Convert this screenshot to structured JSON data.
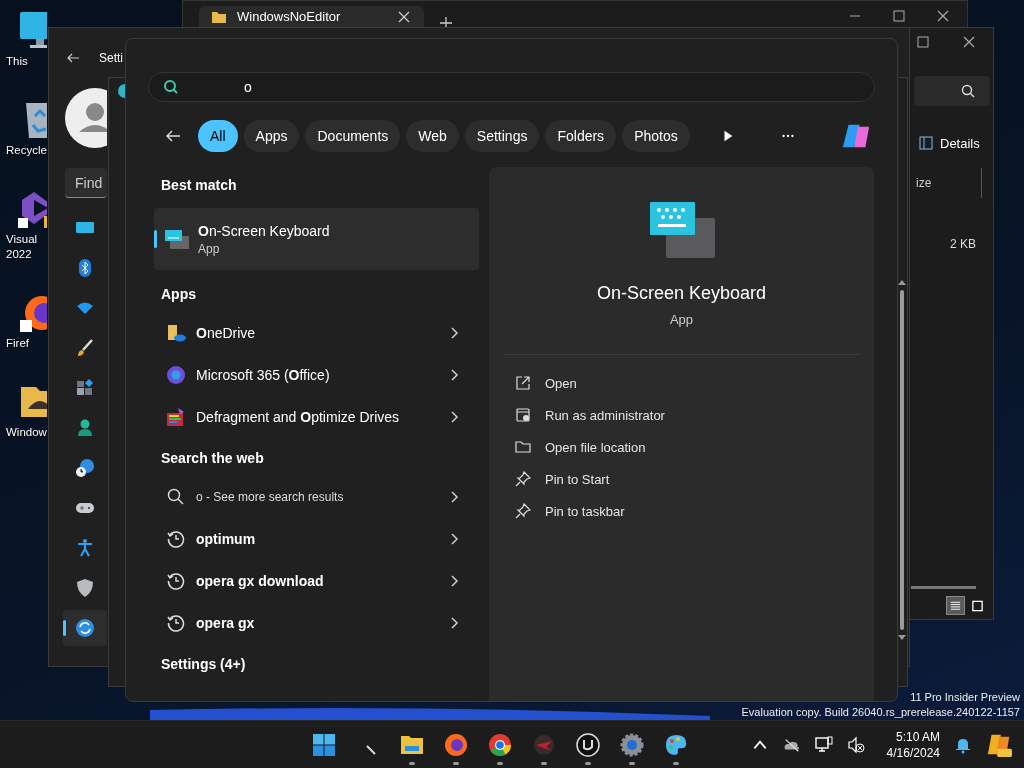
{
  "desktop_icons": [
    {
      "kind": "monitor",
      "lines": [
        "This"
      ]
    },
    {
      "kind": "recycle",
      "lines": [
        "Recycle"
      ]
    },
    {
      "kind": "vs",
      "lines": [
        "Visual",
        "2022"
      ]
    },
    {
      "kind": "firefox",
      "lines": [
        "Firef"
      ]
    },
    {
      "kind": "folder",
      "lines": [
        "Window"
      ]
    }
  ],
  "explorer_tab": {
    "title": "WindowsNoEditor"
  },
  "explorer": {
    "details": "Details",
    "column_1": "ize",
    "file_size": "2 KB",
    "views": [
      {
        "kind": "details",
        "selected": true
      },
      {
        "kind": "tiles",
        "selected": false
      }
    ]
  },
  "settings": {
    "title": "Setti",
    "search_placeholder": "Find",
    "nav": [
      {
        "kind": "display",
        "selected": false
      },
      {
        "kind": "bluetooth",
        "selected": false
      },
      {
        "kind": "wifi",
        "selected": false
      },
      {
        "kind": "brush",
        "selected": false
      },
      {
        "kind": "apps",
        "selected": false
      },
      {
        "kind": "account",
        "selected": false
      },
      {
        "kind": "time",
        "selected": false
      },
      {
        "kind": "gaming",
        "selected": false
      },
      {
        "kind": "accessibility",
        "selected": false
      },
      {
        "kind": "shield",
        "selected": false
      },
      {
        "kind": "update",
        "selected": true
      }
    ]
  },
  "search": {
    "query": "o",
    "filters": [
      {
        "label": "All",
        "selected": true
      },
      {
        "label": "Apps",
        "selected": false
      },
      {
        "label": "Documents",
        "selected": false
      },
      {
        "label": "Web",
        "selected": false
      },
      {
        "label": "Settings",
        "selected": false
      },
      {
        "label": "Folders",
        "selected": false
      },
      {
        "label": "Photos",
        "selected": false
      }
    ],
    "best_match_heading": "Best match",
    "best_match": {
      "name": "**O**n-Screen Keyboard",
      "type": "App",
      "selected": true
    },
    "apps_heading": "Apps",
    "apps": [
      {
        "kind": "onedrive",
        "name": "**O**neDrive"
      },
      {
        "kind": "m365",
        "name": "Microsoft 365 (**O**ffice)"
      },
      {
        "kind": "defrag",
        "name": "Defragment and **O**ptimize Drives"
      }
    ],
    "web_heading": "Search the web",
    "web": [
      {
        "kind": "search",
        "text": "o - See more search results"
      },
      {
        "kind": "history",
        "text": "optimum"
      },
      {
        "kind": "history",
        "text": "opera gx download"
      },
      {
        "kind": "history",
        "text": "opera gx"
      }
    ],
    "settings_heading": "Settings (4+)",
    "detail": {
      "name": "On-Screen Keyboard",
      "type": "App",
      "actions": [
        {
          "kind": "open",
          "label": "Open"
        },
        {
          "kind": "admin",
          "label": "Run as administrator"
        },
        {
          "kind": "folder",
          "label": "Open file location"
        },
        {
          "kind": "pin",
          "label": "Pin to Start"
        },
        {
          "kind": "pin",
          "label": "Pin to taskbar"
        }
      ]
    }
  },
  "build_info": [
    "11 Pro Insider Preview",
    "Evaluation copy. Build 26040.rs_prerelease.240122-1157"
  ],
  "taskbar": {
    "apps": [
      {
        "kind": "start",
        "running": false
      },
      {
        "kind": "pen",
        "running": false
      },
      {
        "kind": "explorer",
        "running": true
      },
      {
        "kind": "firefox",
        "running": true
      },
      {
        "kind": "chrome",
        "running": true
      },
      {
        "kind": "game",
        "running": true
      },
      {
        "kind": "unreal",
        "running": true
      },
      {
        "kind": "settings",
        "running": true
      },
      {
        "kind": "paint",
        "running": true
      }
    ],
    "time": "5:10 AM",
    "date": "4/16/2024"
  }
}
